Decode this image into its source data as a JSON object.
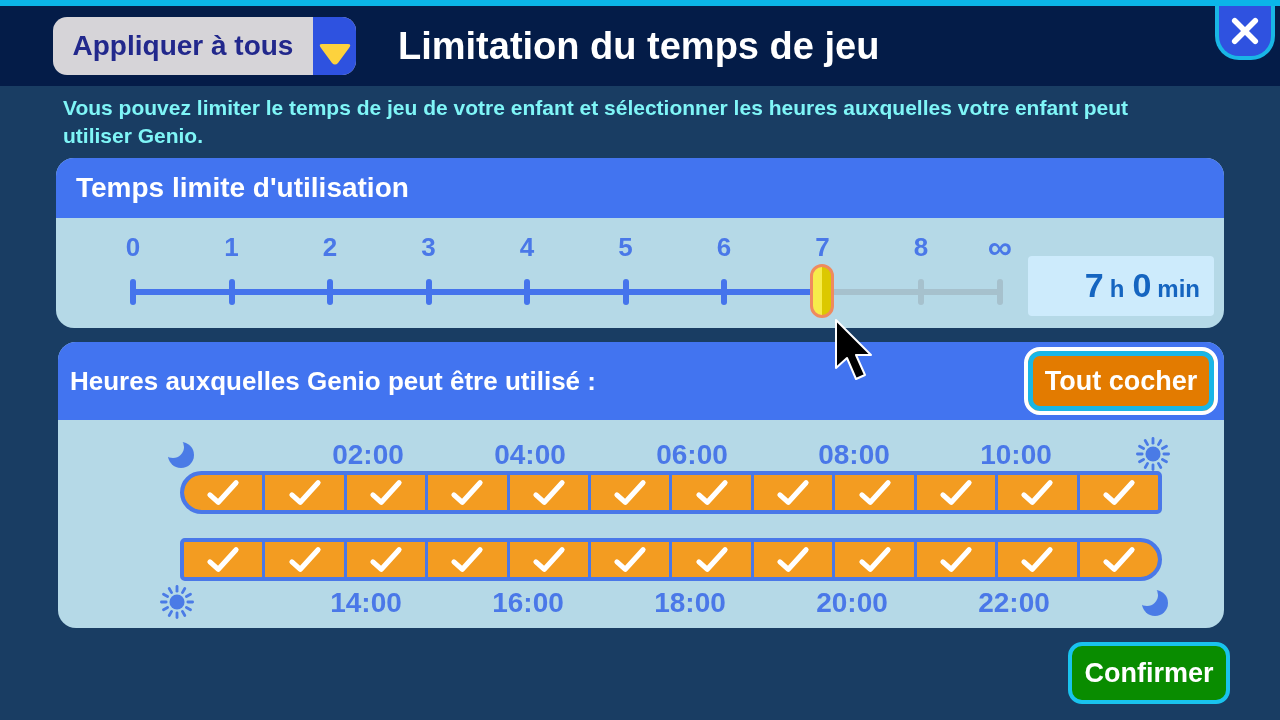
{
  "header": {
    "apply_all_button": "Appliquer à tous",
    "title": "Limitation du temps de jeu"
  },
  "intro": "Vous pouvez limiter le temps de jeu de votre enfant et sélectionner les heures auxquelles votre enfant peut utiliser Genio.",
  "time_limit": {
    "title": "Temps limite d'utilisation",
    "scale": [
      "0",
      "1",
      "2",
      "3",
      "4",
      "5",
      "6",
      "7",
      "8",
      "∞"
    ],
    "level": 0.795,
    "readout": [
      {
        "value": "7",
        "unit": "h"
      },
      {
        "value": "0",
        "unit": "min"
      }
    ]
  },
  "hours": {
    "title": "Heures auxquelles Genio peut être utilisé :",
    "check_all_button": "Tout cocher",
    "rows": [
      {
        "labels": [
          "02:00",
          "04:00",
          "06:00",
          "08:00",
          "10:00"
        ],
        "slots": [
          {
            "checked": true
          },
          {
            "checked": true
          },
          {
            "checked": true
          },
          {
            "checked": true
          },
          {
            "checked": true
          },
          {
            "checked": true
          },
          {
            "checked": true
          },
          {
            "checked": true
          },
          {
            "checked": true
          },
          {
            "checked": true
          },
          {
            "checked": true
          },
          {
            "checked": true
          }
        ]
      },
      {
        "labels": [
          "14:00",
          "16:00",
          "18:00",
          "20:00",
          "22:00"
        ],
        "slots": [
          {
            "checked": true
          },
          {
            "checked": true
          },
          {
            "checked": true
          },
          {
            "checked": true
          },
          {
            "checked": true
          },
          {
            "checked": true
          },
          {
            "checked": true
          },
          {
            "checked": true
          },
          {
            "checked": true
          },
          {
            "checked": true
          },
          {
            "checked": true
          },
          {
            "checked": true
          }
        ]
      }
    ]
  },
  "confirm_button": "Confirmer"
}
